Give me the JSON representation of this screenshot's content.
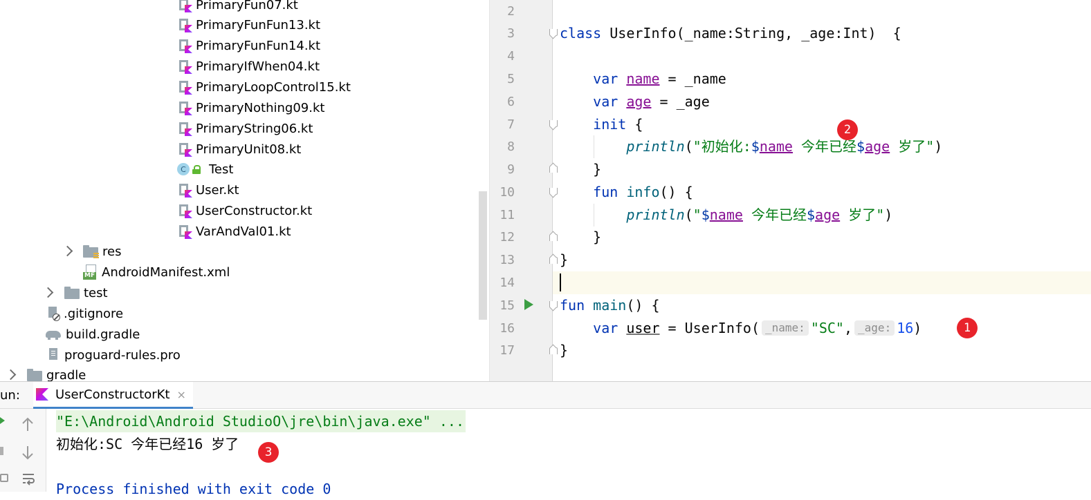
{
  "project_tree": {
    "files": [
      {
        "name": "PrimaryFun07.kt",
        "icon": "kotlin-file-icon"
      },
      {
        "name": "PrimaryFunFun13.kt",
        "icon": "kotlin-file-icon"
      },
      {
        "name": "PrimaryFunFun14.kt",
        "icon": "kotlin-file-icon"
      },
      {
        "name": "PrimaryIfWhen04.kt",
        "icon": "kotlin-file-icon"
      },
      {
        "name": "PrimaryLoopControl15.kt",
        "icon": "kotlin-file-icon"
      },
      {
        "name": "PrimaryNothing09.kt",
        "icon": "kotlin-file-icon"
      },
      {
        "name": "PrimaryString06.kt",
        "icon": "kotlin-file-icon"
      },
      {
        "name": "PrimaryUnit08.kt",
        "icon": "kotlin-file-icon"
      },
      {
        "name": "Test",
        "icon": "kotlin-class-icon"
      },
      {
        "name": "User.kt",
        "icon": "kotlin-file-icon"
      },
      {
        "name": "UserConstructor.kt",
        "icon": "kotlin-file-icon"
      },
      {
        "name": "VarAndVal01.kt",
        "icon": "kotlin-file-icon"
      }
    ],
    "res": "res",
    "manifest": "AndroidManifest.xml",
    "manifest_badge": "MF",
    "test": "test",
    "gitignore": ".gitignore",
    "build_gradle": "build.gradle",
    "proguard": "proguard-rules.pro",
    "gradle": "gradle",
    "class_letter": "C"
  },
  "editor": {
    "line_numbers": [
      "2",
      "3",
      "4",
      "5",
      "6",
      "7",
      "8",
      "9",
      "10",
      "11",
      "12",
      "13",
      "14",
      "15",
      "16",
      "17"
    ],
    "code": {
      "l3_kw": "class",
      "l3_rest": " UserInfo(_name:String, _age:Int)  {",
      "l5_kw": "var",
      "l5_prop": "name",
      "l5_rest": " = _name",
      "l6_kw": "var",
      "l6_prop": "age",
      "l6_rest": " = _age",
      "l7_kw": "init",
      "l7_rest": " {",
      "l8_fn": "println",
      "l8_open": "(",
      "l8_str1": "\"初始化:",
      "l8_dollar1": "$",
      "l8_name": "name",
      "l8_str2": " 今年已经",
      "l8_dollar2": "$",
      "l8_age": "age",
      "l8_str3": " 岁了\"",
      "l8_close": ")",
      "l9": "}",
      "l10_kw": "fun",
      "l10_fn": "info",
      "l10_rest": "() {",
      "l11_fn": "println",
      "l11_open": "(",
      "l11_str1": "\"",
      "l11_dollar1": "$",
      "l11_name": "name",
      "l11_str2": " 今年已经",
      "l11_dollar2": "$",
      "l11_age": "age",
      "l11_str3": " 岁了\"",
      "l11_close": ")",
      "l12": "}",
      "l13": "}",
      "l15_kw": "fun",
      "l15_fn": "main",
      "l15_rest": "() {",
      "l16_kw": "var",
      "l16_var": "user",
      "l16_eq": " = UserInfo(",
      "l16_hint1": "_name:",
      "l16_str": "\"SC\"",
      "l16_comma": ",",
      "l16_hint2": "_age:",
      "l16_num": "16",
      "l16_close": ")",
      "l17": "}"
    },
    "badges": [
      "1",
      "2",
      "3"
    ]
  },
  "run_panel": {
    "label": "un:",
    "tab_name": "UserConstructorKt",
    "tab_close": "×",
    "command": "\"E:\\Android\\Android StudioO\\jre\\bin\\java.exe\" ...",
    "output": "初始化:SC 今年已经16 岁了",
    "process_finished": "Process finished with exit code 0"
  },
  "colors": {
    "keyword": "#0033b3",
    "property": "#871094",
    "string": "#067d17",
    "number": "#1750eb",
    "badge": "#e8232b",
    "current_line": "#fcfaed"
  }
}
